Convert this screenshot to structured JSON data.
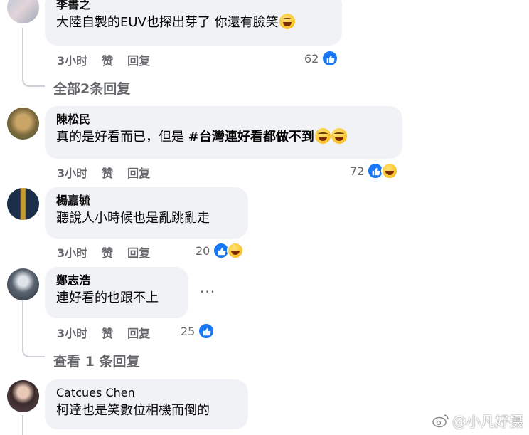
{
  "comments": [
    {
      "author": "李書之",
      "text": "大陸自製的EUV也探出芽了 你還有臉笑",
      "time": "3小时",
      "like_label": "赞",
      "reply_label": "回复",
      "reactions_count": "62",
      "reactions": [
        "like-icon"
      ]
    },
    {
      "author": "陳松民",
      "text_before": "真的是好看而已，但是 ",
      "text_tag": "#台灣連好看都做不到",
      "time": "3小时",
      "like_label": "赞",
      "reply_label": "回复",
      "reactions_count": "72",
      "reactions": [
        "like-icon",
        "haha-icon"
      ]
    },
    {
      "author": "楊嘉毓",
      "text": "聽說人小時候也是亂跳亂走",
      "time": "3小时",
      "like_label": "赞",
      "reply_label": "回复",
      "reactions_count": "20",
      "reactions": [
        "like-icon",
        "haha-icon"
      ]
    },
    {
      "author": "鄭志浩",
      "text": "連好看的也跟不上",
      "time": "3小时",
      "like_label": "赞",
      "reply_label": "回复",
      "reactions_count": "25",
      "reactions": [
        "like-icon"
      ],
      "more_label": "···"
    },
    {
      "author": "Catcues Chen",
      "text": "柯達也是笑數位相機而倒的"
    }
  ],
  "replies_links": {
    "first": "全部2条回复",
    "second": "查看 1 条回复"
  },
  "watermark": "@小凡好摄",
  "colors": {
    "like_blue": "#1877f2",
    "bubble_bg": "#f0f2f5",
    "meta_gray": "#65676b"
  }
}
